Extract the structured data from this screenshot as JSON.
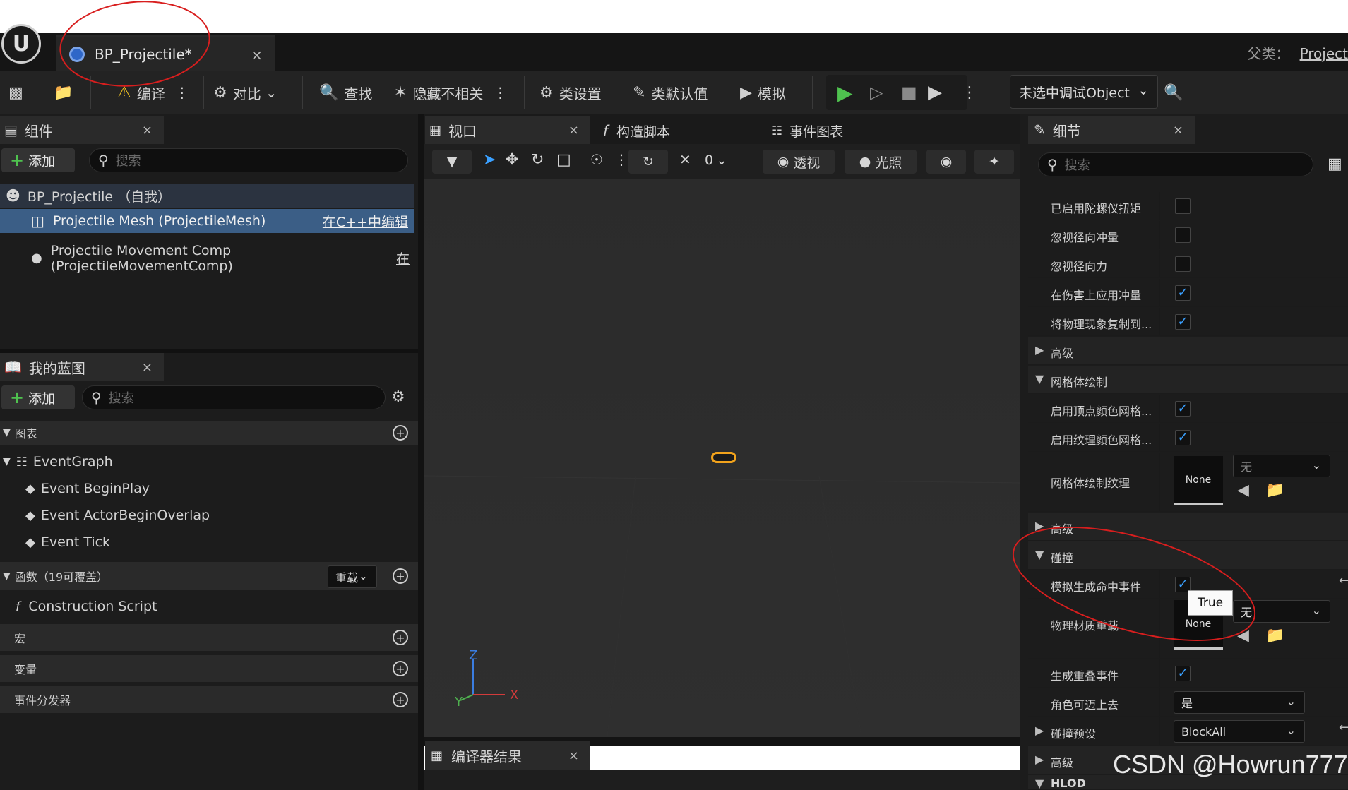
{
  "tab": {
    "title": "BP_Projectile*",
    "close": "×",
    "parent_label": "父类：",
    "parent_value": "Project"
  },
  "toolbar": {
    "compile": "编译",
    "diff": "对比",
    "find": "查找",
    "hide_unrelated": "隐藏不相关",
    "class_settings": "类设置",
    "class_defaults": "类默认值",
    "simulate": "模拟",
    "debug_object": "未选中调试Object"
  },
  "components": {
    "title": "组件",
    "add": "添加",
    "search_placeholder": "搜索",
    "self": "BP_Projectile （自我）",
    "items": [
      {
        "label": "Projectile Mesh (ProjectileMesh)",
        "action": "在C++中编辑"
      },
      {
        "label": "Projectile Movement Comp (ProjectileMovementComp)",
        "action": "在"
      }
    ]
  },
  "my_blueprint": {
    "title": "我的蓝图",
    "add": "添加",
    "search_placeholder": "搜索",
    "graphs_section": "图表",
    "event_graph": "EventGraph",
    "events": [
      "Event BeginPlay",
      "Event ActorBeginOverlap",
      "Event Tick"
    ],
    "functions_section": "函数（19可覆盖）",
    "override": "重载",
    "construction": "Construction Script",
    "macros": "宏",
    "variables": "变量",
    "dispatchers": "事件分发器"
  },
  "center_tabs": {
    "viewport": "视口",
    "construction": "构造脚本",
    "event_graph": "事件图表"
  },
  "viewport_toolbar": {
    "count": "0",
    "perspective": "透视",
    "lighting": "光照"
  },
  "axis": {
    "z": "Z",
    "y": "Y",
    "x": "X"
  },
  "compiler": {
    "title": "编译器结果"
  },
  "details": {
    "title": "细节",
    "search_placeholder": "搜索",
    "rows": [
      {
        "label": "已启用陀螺仪扭矩",
        "checked": false
      },
      {
        "label": "忽视径向冲量",
        "checked": false
      },
      {
        "label": "忽视径向力",
        "checked": false
      },
      {
        "label": "在伤害上应用冲量",
        "checked": true
      },
      {
        "label": "将物理现象复制到...",
        "checked": true
      }
    ],
    "advanced": "高级",
    "mesh_paint_section": "网格体绘制",
    "vertex_color": "启用顶点颜色网格...",
    "texture_color": "启用纹理颜色网格...",
    "mesh_paint_texture": "网格体绘制纹理",
    "none": "None",
    "none_combo": "无",
    "collision_section": "碰撞",
    "sim_hit": "模拟生成命中事件",
    "tooltip": "True",
    "phys_mat": "物理材质重载",
    "gen_overlap": "生成重叠事件",
    "step_up": "角色可迈上去",
    "step_up_value": "是",
    "preset": "碰撞预设",
    "preset_value": "BlockAll",
    "hlod": "HLOD"
  },
  "watermark": "CSDN @Howrun777"
}
